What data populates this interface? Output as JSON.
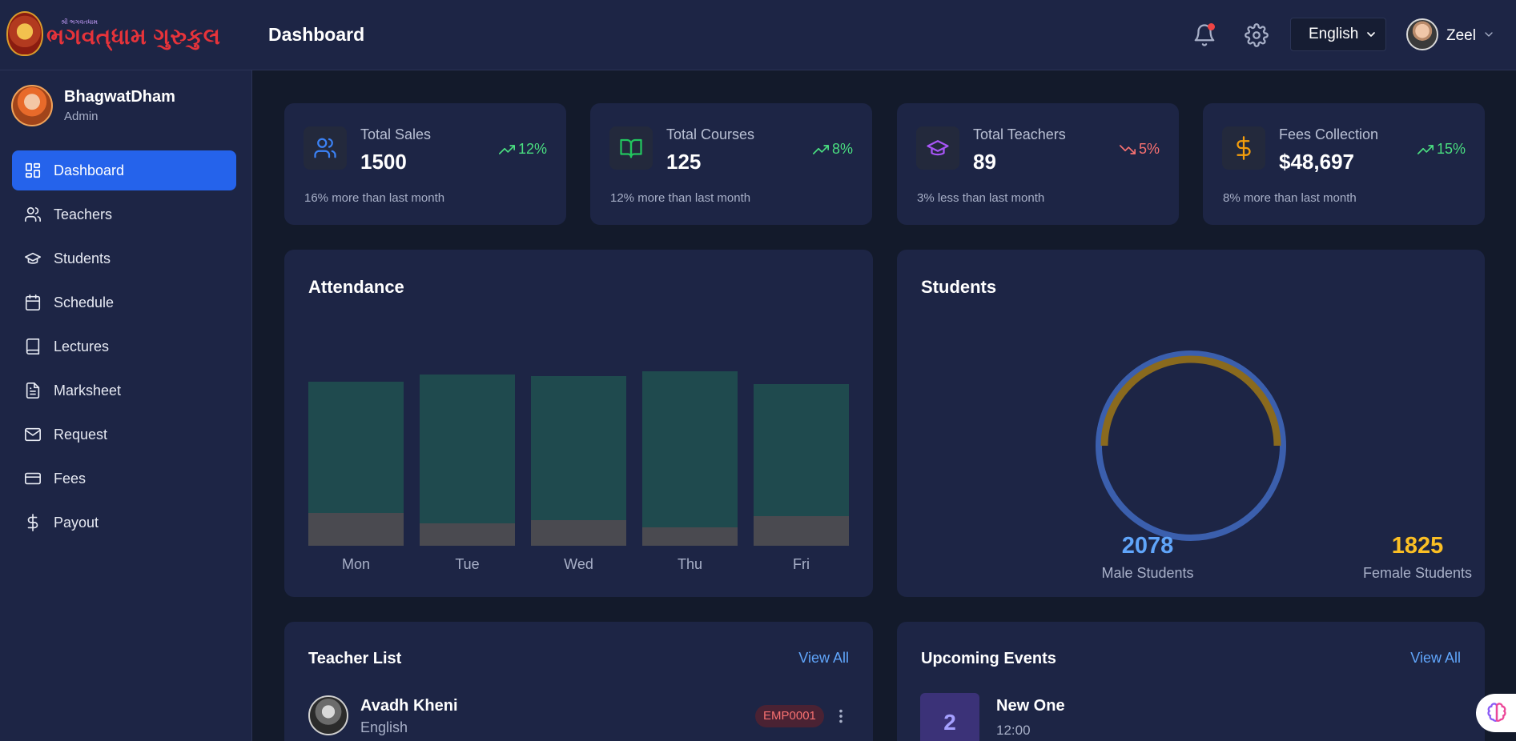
{
  "header": {
    "logo_small": "શ્રી ભગવતધામ",
    "logo_text": "ભગવત્‌ધામ ગુરુકુલ",
    "title": "Dashboard",
    "language": "English",
    "user_name": "Zeel"
  },
  "sidebar": {
    "profile_name": "BhagwatDham",
    "profile_role": "Admin",
    "items": [
      {
        "label": "Dashboard",
        "icon": "dashboard-icon",
        "active": true
      },
      {
        "label": "Teachers",
        "icon": "users-icon"
      },
      {
        "label": "Students",
        "icon": "graduation-cap-icon"
      },
      {
        "label": "Schedule",
        "icon": "calendar-icon"
      },
      {
        "label": "Lectures",
        "icon": "book-icon"
      },
      {
        "label": "Marksheet",
        "icon": "file-text-icon"
      },
      {
        "label": "Request",
        "icon": "mail-icon"
      },
      {
        "label": "Fees",
        "icon": "credit-card-icon"
      },
      {
        "label": "Payout",
        "icon": "dollar-icon"
      }
    ]
  },
  "stats": [
    {
      "label": "Total Sales",
      "value": "1500",
      "trend": "12%",
      "direction": "up",
      "note": "16% more than last month",
      "icon": "users-icon",
      "color": "#3b82f6"
    },
    {
      "label": "Total Courses",
      "value": "125",
      "trend": "8%",
      "direction": "up",
      "note": "12% more than last month",
      "icon": "book-open-icon",
      "color": "#22c55e"
    },
    {
      "label": "Total Teachers",
      "value": "89",
      "trend": "5%",
      "direction": "down",
      "note": "3% less than last month",
      "icon": "graduation-cap-icon",
      "color": "#a855f7"
    },
    {
      "label": "Fees Collection",
      "value": "$48,697",
      "trend": "15%",
      "direction": "up",
      "note": "8% more than last month",
      "icon": "dollar-icon",
      "color": "#f59e0b"
    }
  ],
  "attendance": {
    "title": "Attendance"
  },
  "chart_data": [
    {
      "type": "bar",
      "title": "Attendance",
      "categories": [
        "Mon",
        "Tue",
        "Wed",
        "Thu",
        "Fri"
      ],
      "series": [
        {
          "values": [
            89,
            93,
            92,
            95,
            88
          ]
        },
        {
          "values": [
            18,
            12,
            14,
            10,
            16
          ]
        }
      ]
    },
    {
      "type": "pie",
      "title": "Students",
      "categories": [
        "Male Students",
        "Female Students"
      ],
      "values": [
        2078,
        1825
      ]
    }
  ],
  "students": {
    "title": "Students",
    "male_count": "2078",
    "male_label": "Male Students",
    "female_count": "1825",
    "female_label": "Female Students",
    "male_color": "#3b5fad",
    "female_color": "#8a6a1e"
  },
  "teacher_list": {
    "title": "Teacher List",
    "view_all": "View All",
    "items": [
      {
        "name": "Avadh Kheni",
        "subject": "English",
        "id": "EMP0001"
      }
    ]
  },
  "events": {
    "title": "Upcoming Events",
    "view_all": "View All",
    "items": [
      {
        "day": "2",
        "title": "New One",
        "time": "12:00"
      }
    ]
  }
}
